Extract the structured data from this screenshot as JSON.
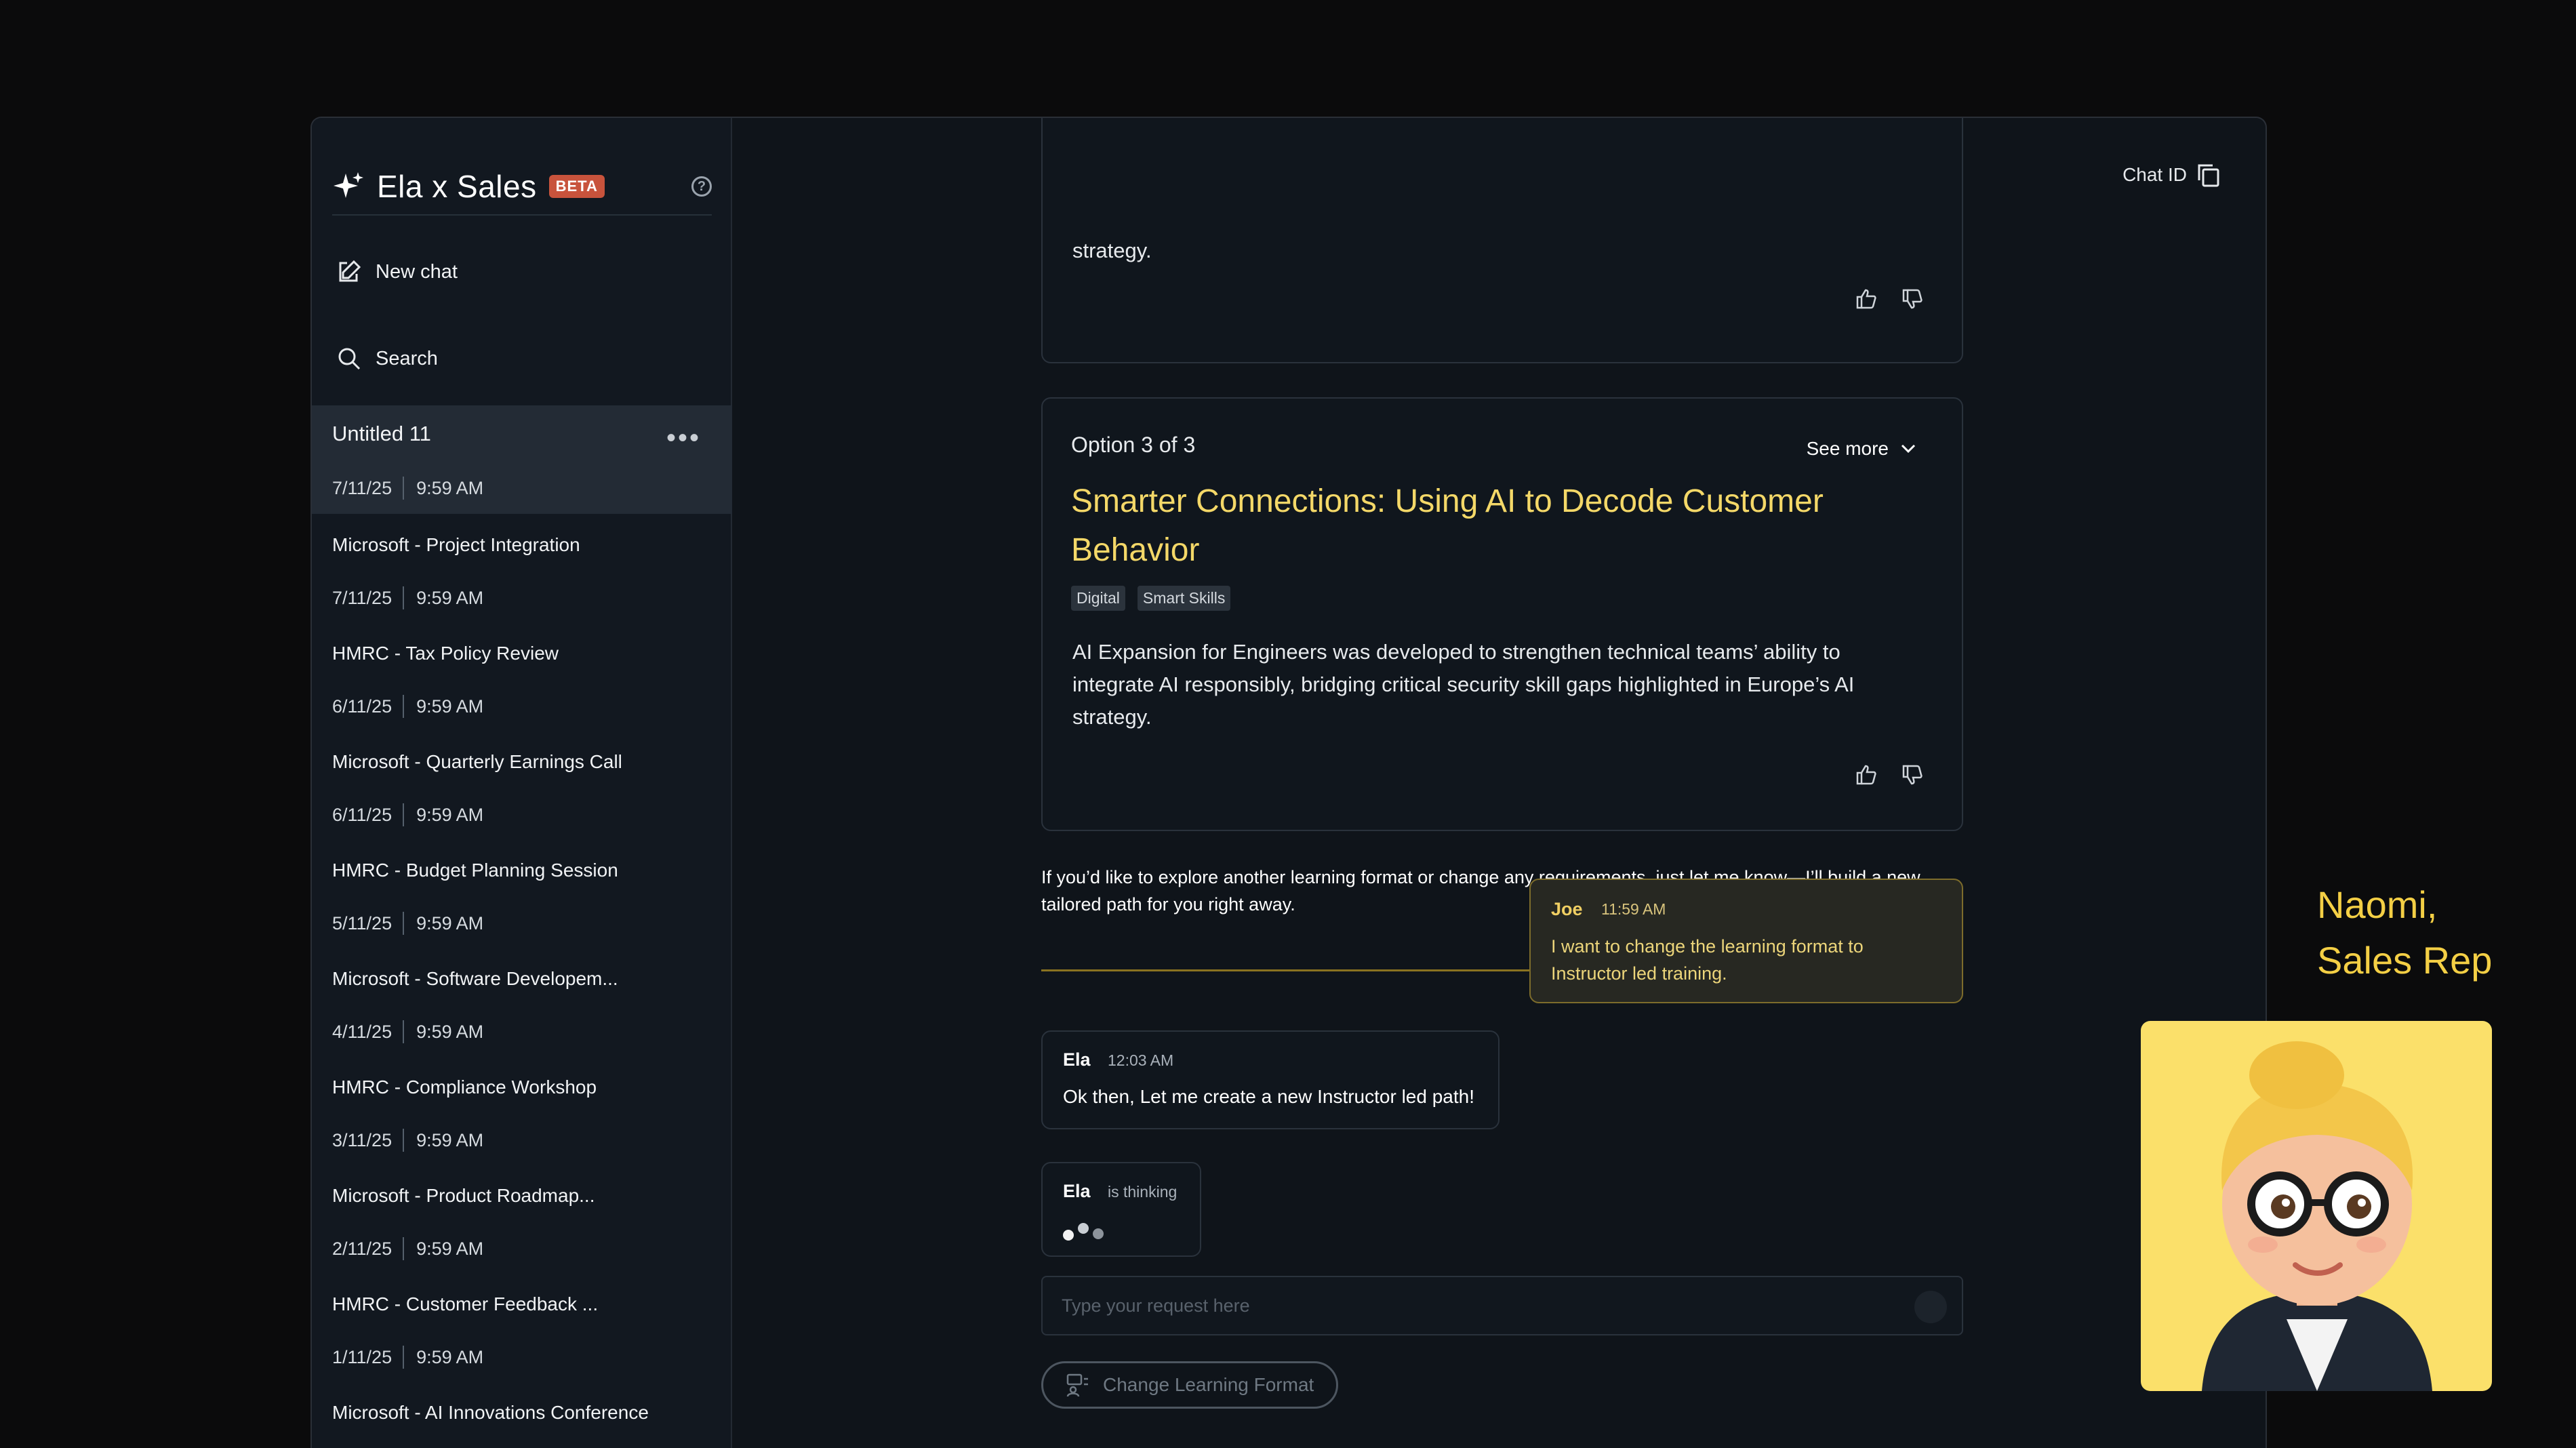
{
  "sidebar": {
    "app_title": "Ela x Sales",
    "beta_badge": "BETA",
    "help_icon": "?",
    "new_chat_label": "New chat",
    "search_label": "Search",
    "chats": [
      {
        "title": "Untitled 11",
        "date": "7/11/25",
        "time": "9:59 AM",
        "active": true
      },
      {
        "title": "Microsoft - Project Integration",
        "date": "7/11/25",
        "time": "9:59 AM"
      },
      {
        "title": "HMRC - Tax Policy Review",
        "date": "6/11/25",
        "time": "9:59 AM"
      },
      {
        "title": "Microsoft - Quarterly Earnings Call",
        "date": "6/11/25",
        "time": "9:59 AM"
      },
      {
        "title": "HMRC - Budget Planning Session",
        "date": "5/11/25",
        "time": "9:59 AM"
      },
      {
        "title": "Microsoft - Software Developem...",
        "date": "4/11/25",
        "time": "9:59 AM"
      },
      {
        "title": "HMRC - Compliance Workshop",
        "date": "3/11/25",
        "time": "9:59 AM"
      },
      {
        "title": "Microsoft - Product Roadmap...",
        "date": "2/11/25",
        "time": "9:59 AM"
      },
      {
        "title": "HMRC - Customer Feedback ...",
        "date": "1/11/25",
        "time": "9:59 AM"
      },
      {
        "title": "Microsoft - AI Innovations Conference",
        "date": "",
        "time": ""
      }
    ]
  },
  "header": {
    "chat_id_label": "Chat ID"
  },
  "conversation": {
    "prev_card_text": "strategy.",
    "option": {
      "label": "Option 3 of 3",
      "see_more": "See more",
      "title": "Smarter Connections: Using AI to Decode Customer Behavior",
      "tags": [
        "Digital",
        "Smart Skills"
      ],
      "description": "AI Expansion for Engineers was developed to strengthen technical teams’ ability to integrate AI responsibly, bridging critical security skill gaps highlighted in Europe’s AI strategy."
    },
    "followup": "If you’d like to explore another learning format or change any requirements, just let me know—I’ll build a new tailored path for you right away.",
    "user_message": {
      "author": "Joe",
      "time": "11:59 AM",
      "text": "I want to change the learning format to Instructor led training."
    },
    "ela_reply": {
      "author": "Ela",
      "time": "12:03 AM",
      "text": "Ok then, Let me create a new Instructor led path!"
    },
    "ela_thinking": {
      "author": "Ela",
      "status": "is thinking"
    }
  },
  "composer": {
    "placeholder": "Type your request here",
    "suggestion_chip": "Change Learning Format"
  },
  "presenter": {
    "line1": "Naomi,",
    "line2": "Sales Rep"
  },
  "colors": {
    "accent_gold": "#f4d868",
    "beta_red": "#c8533c",
    "background": "#0f141a"
  }
}
